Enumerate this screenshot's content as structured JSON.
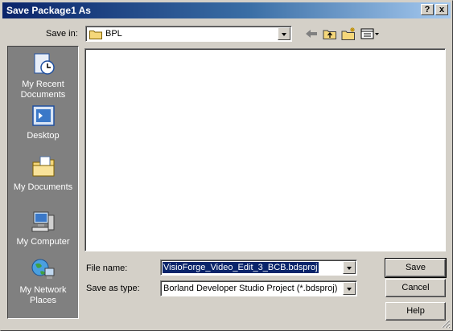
{
  "window": {
    "title": "Save Package1 As",
    "help_btn": "?",
    "close_btn": "x"
  },
  "save_in": {
    "label": "Save in:",
    "value": "BPL"
  },
  "toolbar": {
    "back_icon": "back-arrow-icon",
    "up_icon": "up-folder-icon",
    "new_folder_icon": "new-folder-icon",
    "view_icon": "view-menu-icon"
  },
  "places": [
    {
      "label_line1": "My Recent",
      "label_line2": "Documents",
      "icon": "recent-documents-icon"
    },
    {
      "label_line1": "Desktop",
      "label_line2": "",
      "icon": "desktop-icon"
    },
    {
      "label_line1": "My Documents",
      "label_line2": "",
      "icon": "my-documents-icon"
    },
    {
      "label_line1": "My Computer",
      "label_line2": "",
      "icon": "my-computer-icon"
    },
    {
      "label_line1": "My Network",
      "label_line2": "Places",
      "icon": "network-places-icon"
    }
  ],
  "file_name": {
    "label": "File name:",
    "value": "VisioForge_Video_Edit_3_BCB.bdsproj"
  },
  "save_as_type": {
    "label": "Save as type:",
    "value": "Borland Developer Studio Project (*.bdsproj)"
  },
  "buttons": {
    "save": "Save",
    "cancel": "Cancel",
    "help": "Help"
  },
  "colors": {
    "title_start": "#0a246a",
    "title_end": "#a6caf0",
    "face": "#d4d0c8",
    "places_bg": "#808080"
  }
}
